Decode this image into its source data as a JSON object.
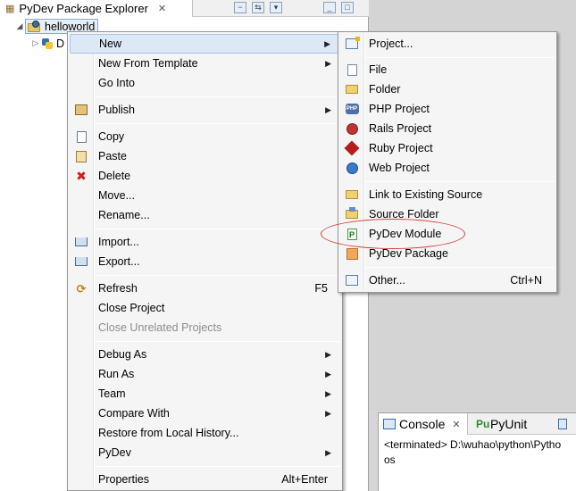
{
  "explorer": {
    "title": "PyDev Package Explorer",
    "tab_close": "✕",
    "tree": {
      "project_name": "helloworld",
      "child_label": "D"
    }
  },
  "context_menu": {
    "items": [
      {
        "label": "New",
        "submenu": true,
        "icon": ""
      },
      {
        "label": "New From Template",
        "submenu": true,
        "icon": ""
      },
      {
        "label": "Go Into",
        "icon": ""
      },
      {
        "label": "Publish",
        "submenu": true,
        "icon": "publish-icon"
      },
      {
        "label": "Copy",
        "icon": "copy-icon"
      },
      {
        "label": "Paste",
        "icon": "paste-icon"
      },
      {
        "label": "Delete",
        "icon": "delete-icon"
      },
      {
        "label": "Move...",
        "icon": ""
      },
      {
        "label": "Rename...",
        "icon": ""
      },
      {
        "label": "Import...",
        "icon": "import-icon"
      },
      {
        "label": "Export...",
        "icon": "export-icon"
      },
      {
        "label": "Refresh",
        "accel": "F5",
        "icon": "refresh-icon"
      },
      {
        "label": "Close Project",
        "icon": ""
      },
      {
        "label": "Close Unrelated Projects",
        "disabled": true,
        "icon": ""
      },
      {
        "label": "Debug As",
        "submenu": true,
        "icon": ""
      },
      {
        "label": "Run As",
        "submenu": true,
        "icon": ""
      },
      {
        "label": "Team",
        "submenu": true,
        "icon": ""
      },
      {
        "label": "Compare With",
        "submenu": true,
        "icon": ""
      },
      {
        "label": "Restore from Local History...",
        "icon": ""
      },
      {
        "label": "PyDev",
        "submenu": true,
        "icon": ""
      },
      {
        "label": "Properties",
        "accel": "Alt+Enter",
        "icon": ""
      }
    ]
  },
  "new_submenu": {
    "items": [
      {
        "label": "Project...",
        "icon": "new-project-icon"
      },
      {
        "label": "File",
        "icon": "file-icon"
      },
      {
        "label": "Folder",
        "icon": "folder-icon"
      },
      {
        "label": "PHP Project",
        "icon": "php-project-icon"
      },
      {
        "label": "Rails Project",
        "icon": "rails-project-icon"
      },
      {
        "label": "Ruby Project",
        "icon": "ruby-project-icon"
      },
      {
        "label": "Web Project",
        "icon": "web-project-icon"
      },
      {
        "label": "Link to Existing Source",
        "icon": "link-source-icon"
      },
      {
        "label": "Source Folder",
        "icon": "source-folder-icon"
      },
      {
        "label": "PyDev Module",
        "icon": "pydev-module-icon"
      },
      {
        "label": "PyDev Package",
        "icon": "pydev-package-icon"
      },
      {
        "label": "Other...",
        "accel": "Ctrl+N",
        "icon": "other-wizard-icon"
      }
    ]
  },
  "console": {
    "tabs": [
      {
        "label": "Console",
        "close": "✕"
      },
      {
        "label": "PyUnit"
      }
    ],
    "lines": [
      "<terminated> D:\\wuhao\\python\\Pytho",
      "os"
    ]
  },
  "colors": {
    "menu_highlight": "#dce8f6",
    "annotation_ellipse": "#d84040"
  }
}
